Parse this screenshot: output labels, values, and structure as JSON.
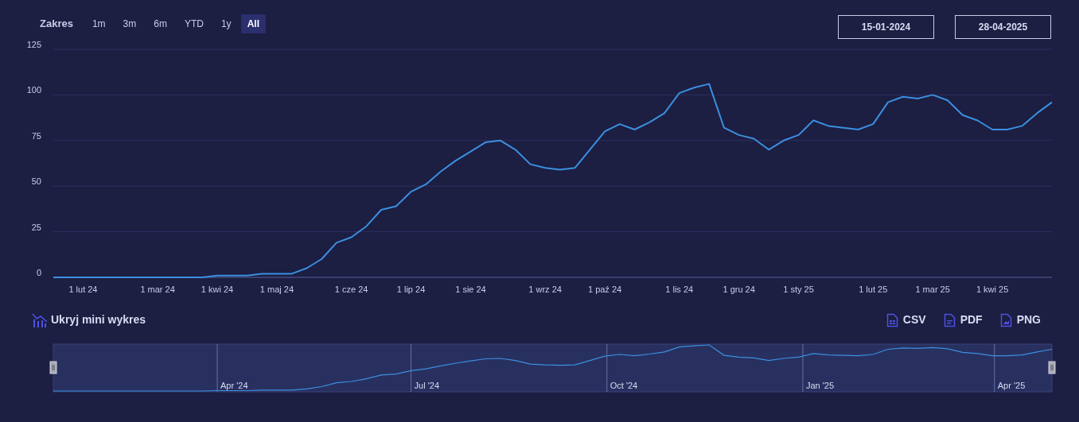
{
  "range_selector": {
    "label": "Zakres",
    "buttons": [
      {
        "label": "1m",
        "selected": false
      },
      {
        "label": "3m",
        "selected": false
      },
      {
        "label": "6m",
        "selected": false
      },
      {
        "label": "YTD",
        "selected": false
      },
      {
        "label": "1y",
        "selected": false
      },
      {
        "label": "All",
        "selected": true
      }
    ]
  },
  "date_range": {
    "start": "15-01-2024",
    "end": "28-04-2025"
  },
  "chart": {
    "chart_data": {
      "type": "line",
      "categories": [
        null,
        null,
        "1 lut 24",
        null,
        null,
        null,
        null,
        "1 mar 24",
        null,
        null,
        null,
        "1 kwi 24",
        null,
        null,
        null,
        "1 maj 24",
        null,
        null,
        null,
        null,
        "1 cze 24",
        null,
        null,
        null,
        "1 lip 24",
        null,
        null,
        null,
        "1 sie 24",
        null,
        null,
        null,
        null,
        "1 wrz 24",
        null,
        null,
        null,
        "1 paź 24",
        null,
        null,
        null,
        null,
        "1 lis 24",
        null,
        null,
        null,
        "1 gru 24",
        null,
        null,
        null,
        "1 sty 25",
        null,
        null,
        null,
        null,
        "1 lut 25",
        null,
        null,
        null,
        "1 mar 25",
        null,
        null,
        null,
        "1 kwi 25",
        null,
        null,
        null,
        null
      ],
      "series": [
        {
          "color": "#3b8fe0",
          "values": [
            0,
            0,
            0,
            0,
            0,
            0,
            0,
            0,
            0,
            0,
            0,
            1,
            1,
            1,
            2,
            2,
            2,
            5,
            10,
            19,
            22,
            28,
            37,
            39,
            47,
            51,
            58,
            64,
            69,
            74,
            75,
            70,
            62,
            60,
            59,
            60,
            70,
            80,
            84,
            81,
            85,
            90,
            101,
            104,
            106,
            82,
            78,
            76,
            70,
            75,
            78,
            86,
            83,
            82,
            81,
            84,
            96,
            99,
            98,
            100,
            97,
            89,
            86,
            81,
            81,
            83,
            90,
            96
          ]
        }
      ],
      "grid": true,
      "ylim": [
        0,
        125
      ],
      "yticks": [
        0,
        25,
        50,
        75,
        100,
        125
      ]
    }
  },
  "mini_chart_toggle": {
    "label": "Ukryj mini wykres"
  },
  "exports": [
    {
      "label": "CSV",
      "kind": "csv"
    },
    {
      "label": "PDF",
      "kind": "pdf"
    },
    {
      "label": "PNG",
      "kind": "png"
    }
  ],
  "navigator": {
    "labels": [
      "Apr '24",
      "Jul '24",
      "Oct '24",
      "Jan '25",
      "Apr '25"
    ]
  }
}
